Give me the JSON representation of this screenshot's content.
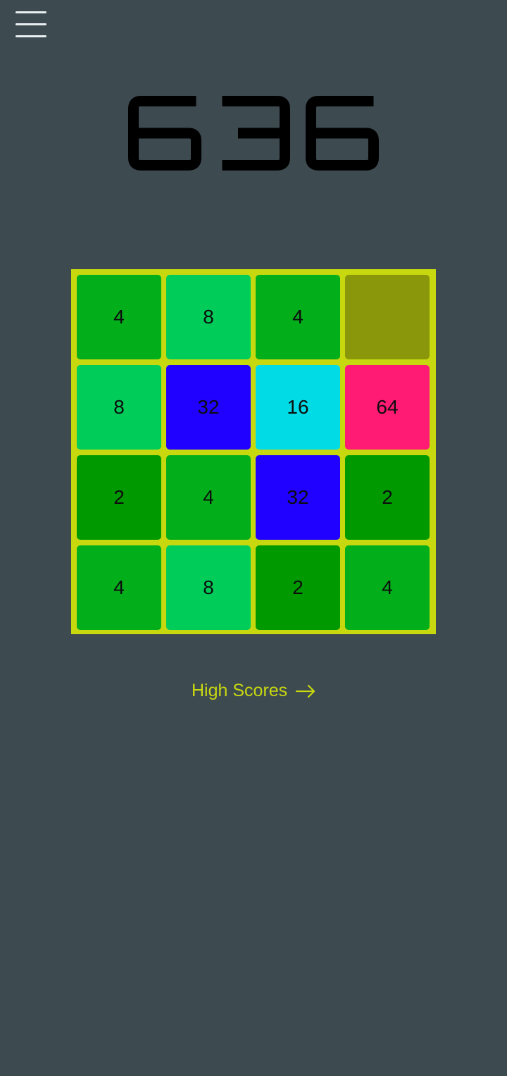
{
  "app": {
    "background_color": "#3d4a50"
  },
  "menu": {
    "icon": "hamburger-menu-icon",
    "color": "#e9eef0"
  },
  "score": {
    "value": "636",
    "color": "#000000"
  },
  "board": {
    "background_color": "#c8d80f",
    "tiles": [
      {
        "value": "4",
        "color": "#03ae1b"
      },
      {
        "value": "8",
        "color": "#00cc5a"
      },
      {
        "value": "4",
        "color": "#03ae1b"
      },
      {
        "value": "",
        "color": "#8a970a"
      },
      {
        "value": "8",
        "color": "#00cc5a"
      },
      {
        "value": "32",
        "color": "#2000ff"
      },
      {
        "value": "16",
        "color": "#00dbe6"
      },
      {
        "value": "64",
        "color": "#ff1b74"
      },
      {
        "value": "2",
        "color": "#009a00"
      },
      {
        "value": "4",
        "color": "#03ae1b"
      },
      {
        "value": "32",
        "color": "#2000ff"
      },
      {
        "value": "2",
        "color": "#009a00"
      },
      {
        "value": "4",
        "color": "#03ae1b"
      },
      {
        "value": "8",
        "color": "#00cc5a"
      },
      {
        "value": "2",
        "color": "#009a00"
      },
      {
        "value": "4",
        "color": "#03ae1b"
      }
    ]
  },
  "high_scores": {
    "label": "High Scores",
    "icon": "arrow-right-icon",
    "color": "#c8d80f"
  }
}
